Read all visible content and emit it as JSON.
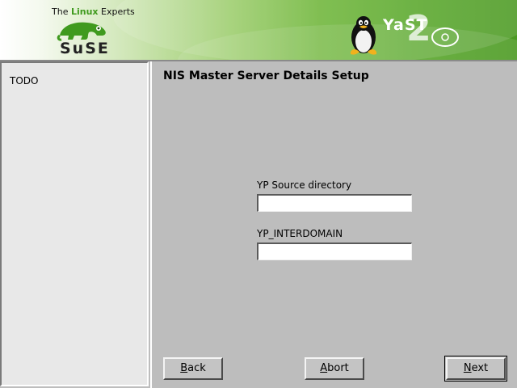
{
  "header": {
    "tagline_prefix": "The ",
    "tagline_highlight": "Linux",
    "tagline_suffix": " Experts",
    "brand_wordmark": "SuSE",
    "product_wordmark": "YaST",
    "product_version_mark": "2",
    "icons": [
      "chameleon-logo",
      "tux-penguin-logo",
      "yast2-badge"
    ],
    "colors": {
      "banner_green": "#5aa82c",
      "highlight_green": "#3f9a1e"
    }
  },
  "help": {
    "text": "TODO"
  },
  "dialog": {
    "title": "NIS Master Server Details Setup",
    "fields": [
      {
        "label": "YP Source directory",
        "value": ""
      },
      {
        "label": "YP_INTERDOMAIN",
        "value": ""
      }
    ]
  },
  "buttons": {
    "back": {
      "mnemonic": "B",
      "rest": "ack"
    },
    "abort": {
      "mnemonic": "A",
      "rest": "bort"
    },
    "next": {
      "mnemonic": "N",
      "rest": "ext"
    }
  }
}
